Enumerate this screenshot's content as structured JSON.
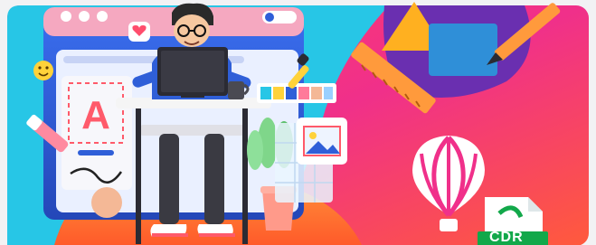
{
  "file_badge": {
    "label": "CDR"
  },
  "colors": {
    "frame_bg": "#f2f2f4",
    "cyan": "#27c6e6",
    "magenta": "#f0308a",
    "orange": "#ff7a2f",
    "purple": "#6a2fb0",
    "blue_screen": "#2f5fd8",
    "badge_green": "#12a84a"
  }
}
